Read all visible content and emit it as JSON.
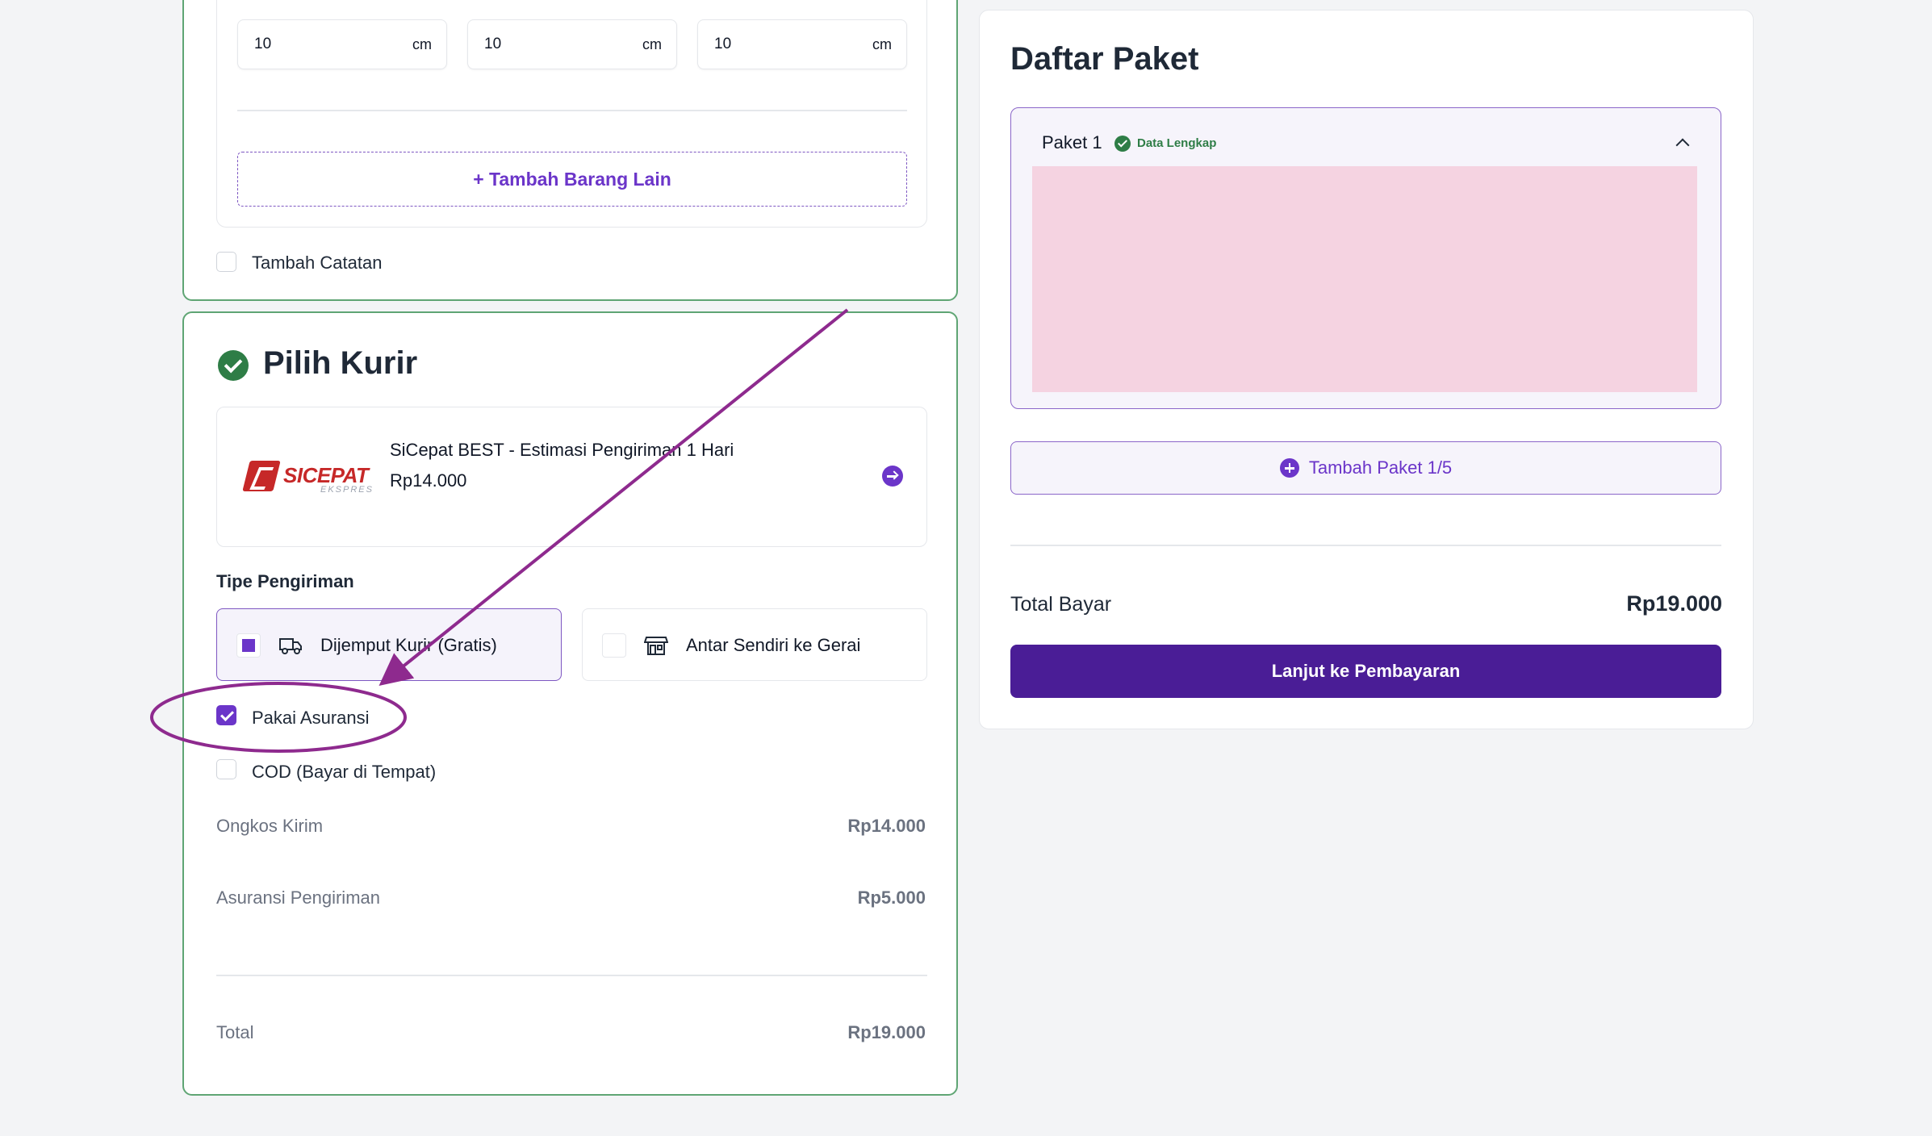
{
  "dimensions": {
    "length": {
      "value": "10",
      "unit": "cm"
    },
    "width": {
      "value": "10",
      "unit": "cm"
    },
    "height": {
      "value": "10",
      "unit": "cm"
    }
  },
  "add_item_label": "+ Tambah Barang Lain",
  "note_checkbox": {
    "label": "Tambah Catatan",
    "checked": false
  },
  "courier_section": {
    "title": "Pilih Kurir",
    "courier": {
      "logo_text": "SICEPAT",
      "logo_sub": "EKSPRES",
      "name": "SiCepat BEST - Estimasi Pengiriman 1 Hari",
      "price": "Rp14.000"
    },
    "shipping_type_label": "Tipe Pengiriman",
    "options": [
      {
        "label": "Dijemput Kurir (Gratis)",
        "icon": "truck-icon",
        "selected": true
      },
      {
        "label": "Antar Sendiri ke Gerai",
        "icon": "store-icon",
        "selected": false
      }
    ],
    "insurance": {
      "label": "Pakai Asuransi",
      "checked": true
    },
    "cod": {
      "label": "COD (Bayar di Tempat)",
      "checked": false
    },
    "summary": {
      "shipping_label": "Ongkos Kirim",
      "shipping_value": "Rp14.000",
      "insurance_label": "Asuransi Pengiriman",
      "insurance_value": "Rp5.000",
      "total_label": "Total",
      "total_value": "Rp19.000"
    }
  },
  "package_list": {
    "title": "Daftar Paket",
    "package": {
      "label": "Paket 1",
      "status": "Data Lengkap"
    },
    "add_package_label": "Tambah Paket 1/5",
    "total_label": "Total Bayar",
    "total_value": "Rp19.000",
    "pay_button": "Lanjut ke Pembayaran"
  },
  "colors": {
    "accent": "#6b35c9",
    "primary_button": "#4a1d96",
    "success": "#2e7d46",
    "annotation": "#8e2a8e",
    "placeholder": "#f5d3e1"
  }
}
